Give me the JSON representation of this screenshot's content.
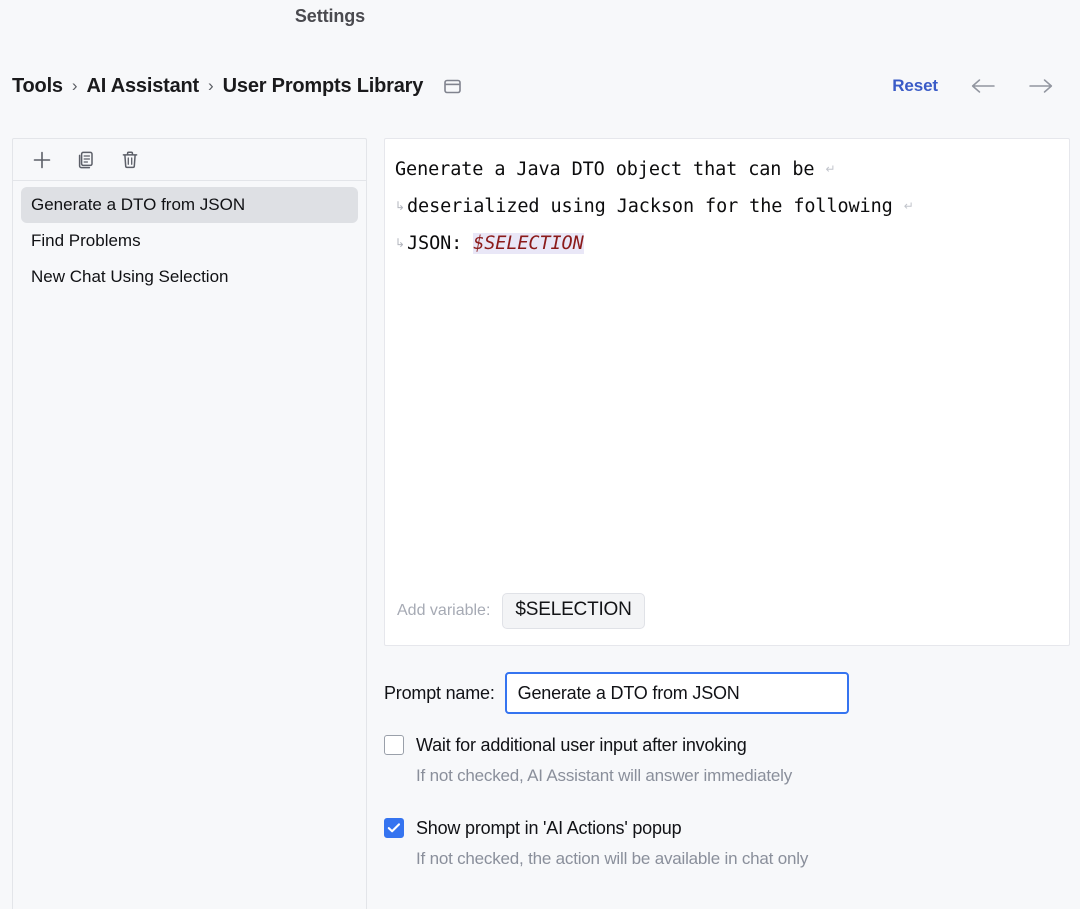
{
  "window": {
    "title": "Settings"
  },
  "breadcrumb": {
    "items": [
      "Tools",
      "AI Assistant",
      "User Prompts Library"
    ],
    "separator": "›",
    "panel_toggle_icon": "panel-layout-icon",
    "reset_label": "Reset",
    "back_icon": "arrow-left-icon",
    "forward_icon": "arrow-right-icon"
  },
  "list_panel": {
    "toolbar": [
      {
        "name": "add-prompt-button",
        "icon": "plus-icon"
      },
      {
        "name": "duplicate-prompt-button",
        "icon": "copy-icon"
      },
      {
        "name": "delete-prompt-button",
        "icon": "trash-icon"
      }
    ],
    "items": [
      {
        "label": "Generate a DTO from JSON",
        "selected": true
      },
      {
        "label": "Find Problems",
        "selected": false
      },
      {
        "label": "New Chat Using Selection",
        "selected": false
      }
    ]
  },
  "editor": {
    "lines": [
      {
        "lead_wrap": false,
        "text": "Generate a Java DTO object that can be ",
        "tail_wrap": true
      },
      {
        "lead_wrap": true,
        "text": "deserialized using Jackson for the following ",
        "tail_wrap": true
      },
      {
        "lead_wrap": true,
        "text": "JSON: ",
        "tail_wrap": false
      }
    ],
    "full_text": "Generate a Java DTO object that can be deserialized using Jackson for the following JSON: $SELECTION",
    "variable_token": "$SELECTION",
    "wrap_lead_glyph": "↳",
    "wrap_tail_glyph": "↵",
    "add_variable_label": "Add variable:",
    "add_variable_button": "$SELECTION",
    "variable_color": "#8B1A1A",
    "variable_highlight": "#E9E7F7"
  },
  "form": {
    "prompt_name_label": "Prompt name:",
    "prompt_name_value": "Generate a DTO from JSON",
    "prompt_name_placeholder": "Prompt name",
    "checkboxes": [
      {
        "label": "Wait for additional user input after invoking",
        "hint": "If not checked, AI Assistant will answer immediately",
        "checked": false
      },
      {
        "label": "Show prompt in 'AI Actions' popup",
        "hint": "If not checked, the action will be available in chat only",
        "checked": true
      }
    ]
  },
  "colors": {
    "accent": "#3574F0",
    "link": "#3A5BC7",
    "background": "#F7F8FA",
    "selection": "#DEE0E4"
  }
}
